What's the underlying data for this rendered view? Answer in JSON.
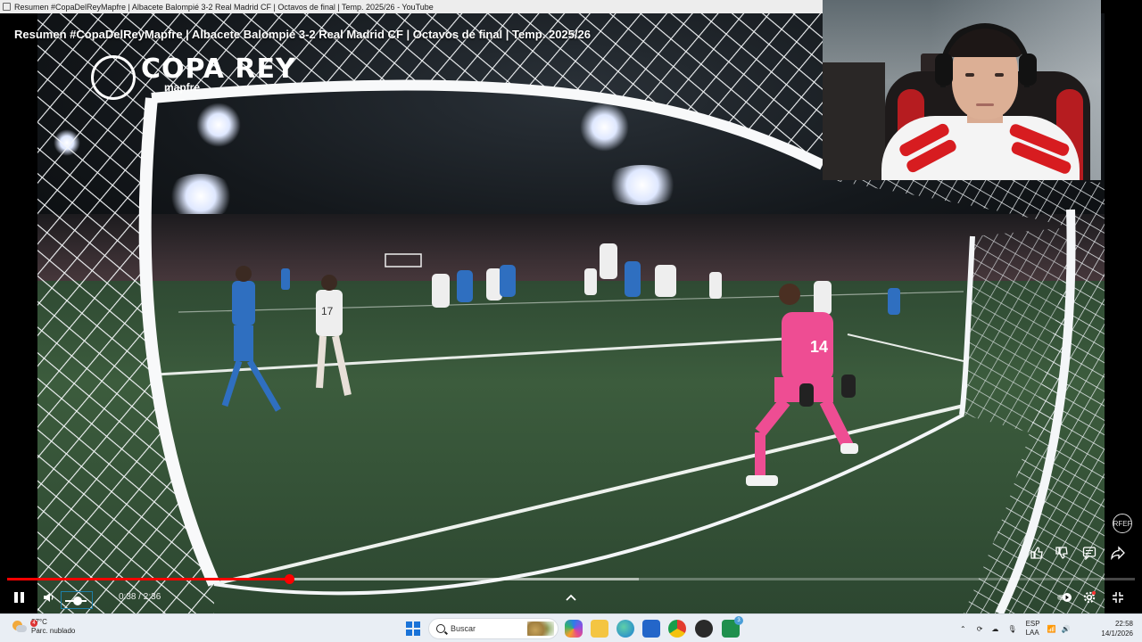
{
  "window": {
    "title": "Resumen #CopaDelReyMapfre | Albacete Balompié 3-2 Real Madrid CF | Octavos de final | Temp. 2025/26 - YouTube"
  },
  "video": {
    "overlay_title": "Resumen #CopaDelReyMapfre | Albacete Balompié 3-2 Real Madrid CF | Octavos de final | Temp. 2025/26",
    "brand_main": "COPA REY",
    "brand_sub": "mapfre",
    "goalkeeper_number": "14",
    "player_number": "17",
    "rfef_badge": "RFEF"
  },
  "player": {
    "current_time": "0:38",
    "duration": "2:36",
    "time_display": "0:38 / 2:36",
    "played_fraction": 0.25,
    "buffered_fraction": 0.56,
    "volume_fraction": 0.45,
    "colors": {
      "progress": "#ff0000",
      "accent": "#1e7fa8"
    }
  },
  "icons": {
    "pause": "pause-icon",
    "volume": "volume-icon",
    "chevron": "chevron-up-icon",
    "like": "thumbs-up-icon",
    "dislike": "thumbs-down-icon",
    "comment": "comment-icon",
    "share": "share-icon",
    "autoplay": "autoplay-icon",
    "settings": "gear-icon",
    "exit_fullscreen": "exit-fullscreen-icon"
  },
  "taskbar": {
    "weather_temp": "27°C",
    "weather_desc": "Parc. nublado",
    "weather_badge": "4",
    "search_placeholder": "Buscar",
    "lang_top": "ESP",
    "lang_bottom": "LAA",
    "time": "22:58",
    "date": "14/1/2026",
    "store_badge": "3"
  }
}
